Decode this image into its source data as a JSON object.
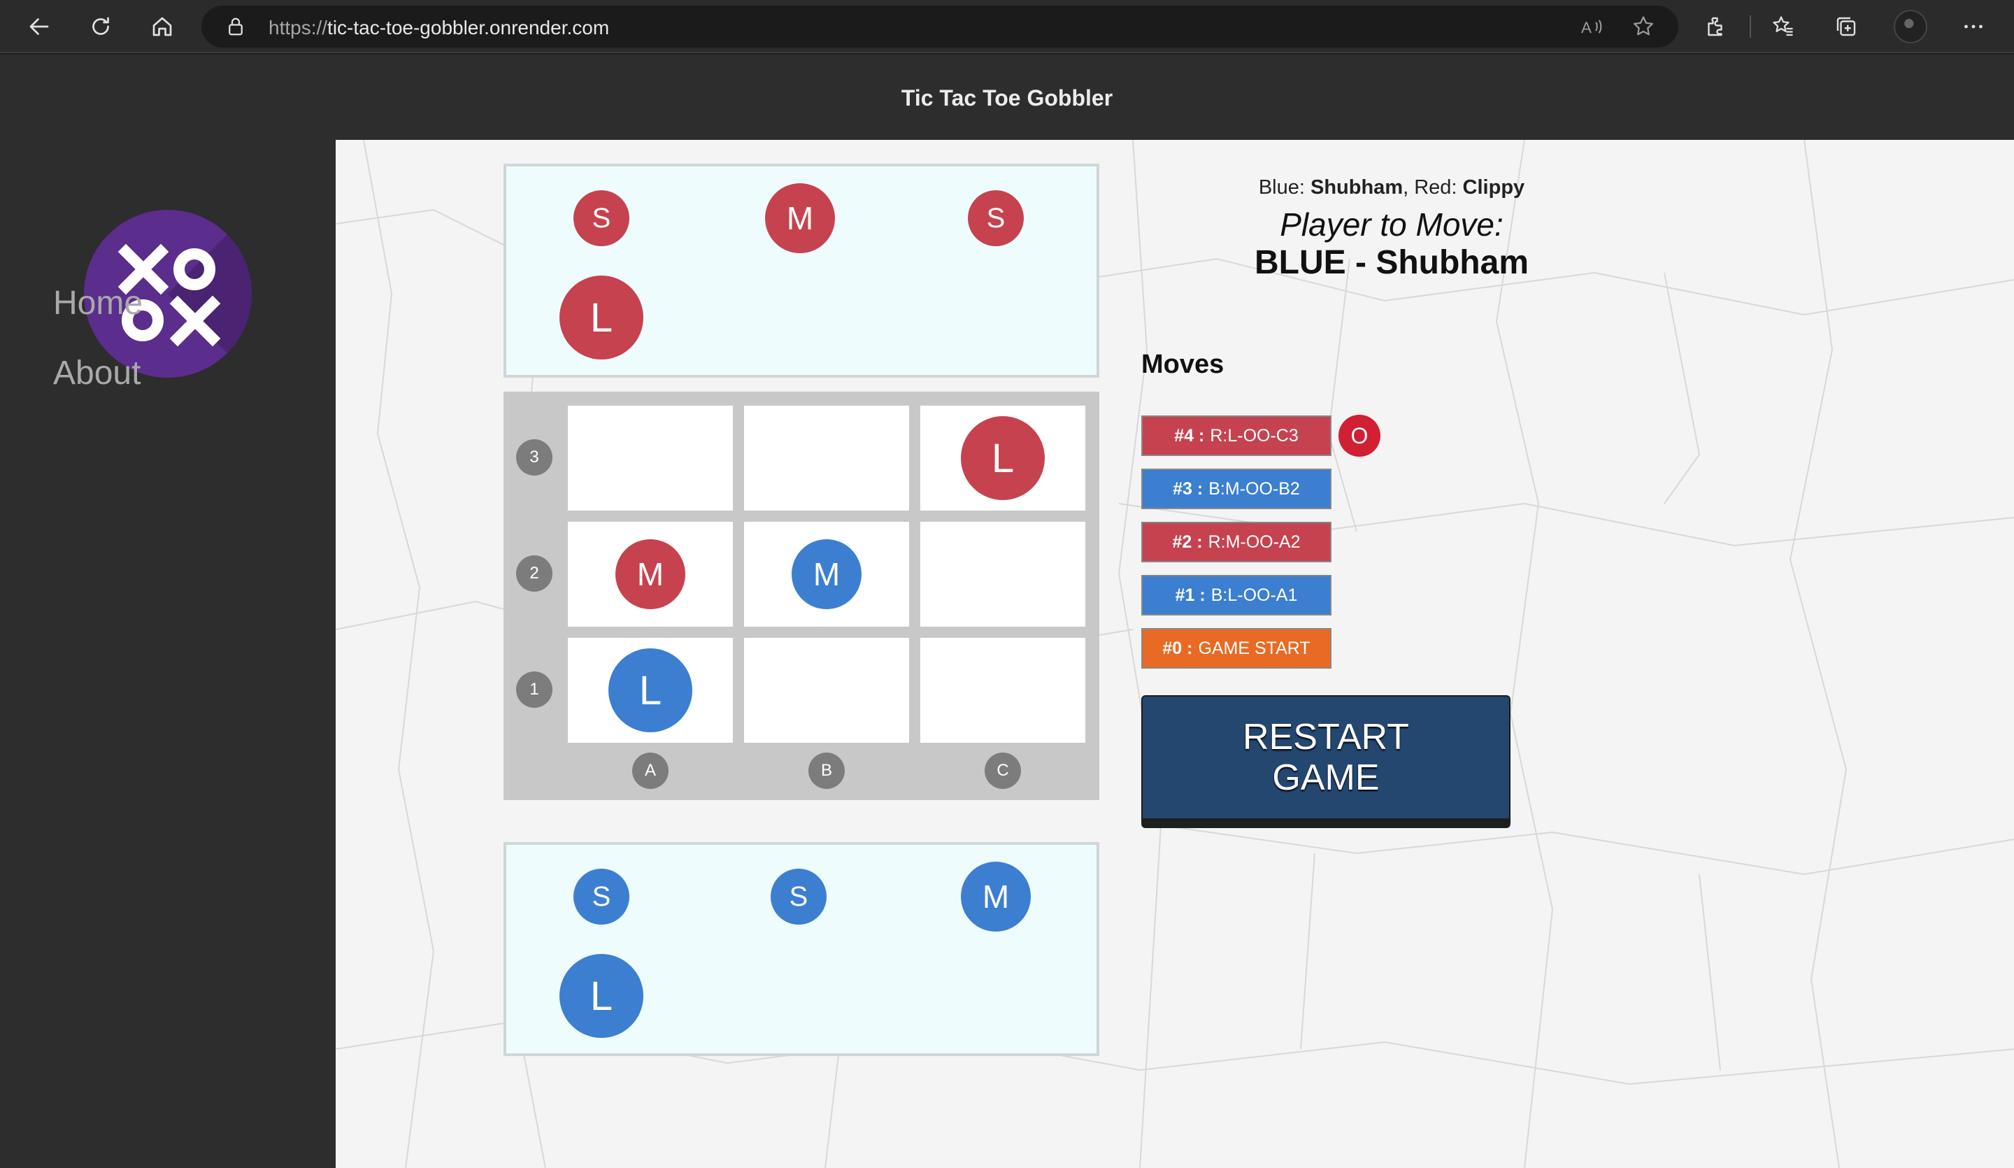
{
  "browser": {
    "url_scheme": "https://",
    "url_host": "tic-tac-toe-gobbler.onrender.com"
  },
  "app": {
    "title": "Tic Tac Toe Gobbler",
    "logo_text": "XO OX"
  },
  "sidebar": {
    "items": [
      {
        "label": "Home"
      },
      {
        "label": "About"
      }
    ]
  },
  "status": {
    "blue_label": "Blue: ",
    "blue_player": "Shubham",
    "red_label": ", Red: ",
    "red_player": "Clippy",
    "player_to_move_label": "Player to Move:",
    "current_turn": "BLUE - Shubham"
  },
  "red_tray": {
    "pieces": [
      "S",
      "M",
      "S",
      "L"
    ]
  },
  "blue_tray": {
    "pieces": [
      "S",
      "S",
      "M",
      "L"
    ]
  },
  "board": {
    "row_labels": [
      "3",
      "2",
      "1"
    ],
    "col_labels": [
      "A",
      "B",
      "C"
    ],
    "pieces": {
      "C3": {
        "size": "L",
        "color": "red"
      },
      "A2": {
        "size": "M",
        "color": "red"
      },
      "B2": {
        "size": "M",
        "color": "blue"
      },
      "A1": {
        "size": "L",
        "color": "blue"
      }
    }
  },
  "moves": {
    "title": "Moves",
    "list": [
      {
        "num": "#4 :",
        "text": "R:L-OO-C3",
        "color": "red"
      },
      {
        "num": "#3 :",
        "text": "B:M-OO-B2",
        "color": "blue"
      },
      {
        "num": "#2 :",
        "text": "R:M-OO-A2",
        "color": "red"
      },
      {
        "num": "#1 :",
        "text": "B:L-OO-A1",
        "color": "blue"
      },
      {
        "num": "#0 :",
        "text": "GAME START",
        "color": "orange"
      }
    ],
    "current_marker": "O"
  },
  "restart_label": "RESTART GAME",
  "colors": {
    "red": "#c6424f",
    "blue": "#3c7fd1",
    "orange": "#e96a24",
    "restart": "#244770",
    "logo": "#5b2d8c"
  }
}
